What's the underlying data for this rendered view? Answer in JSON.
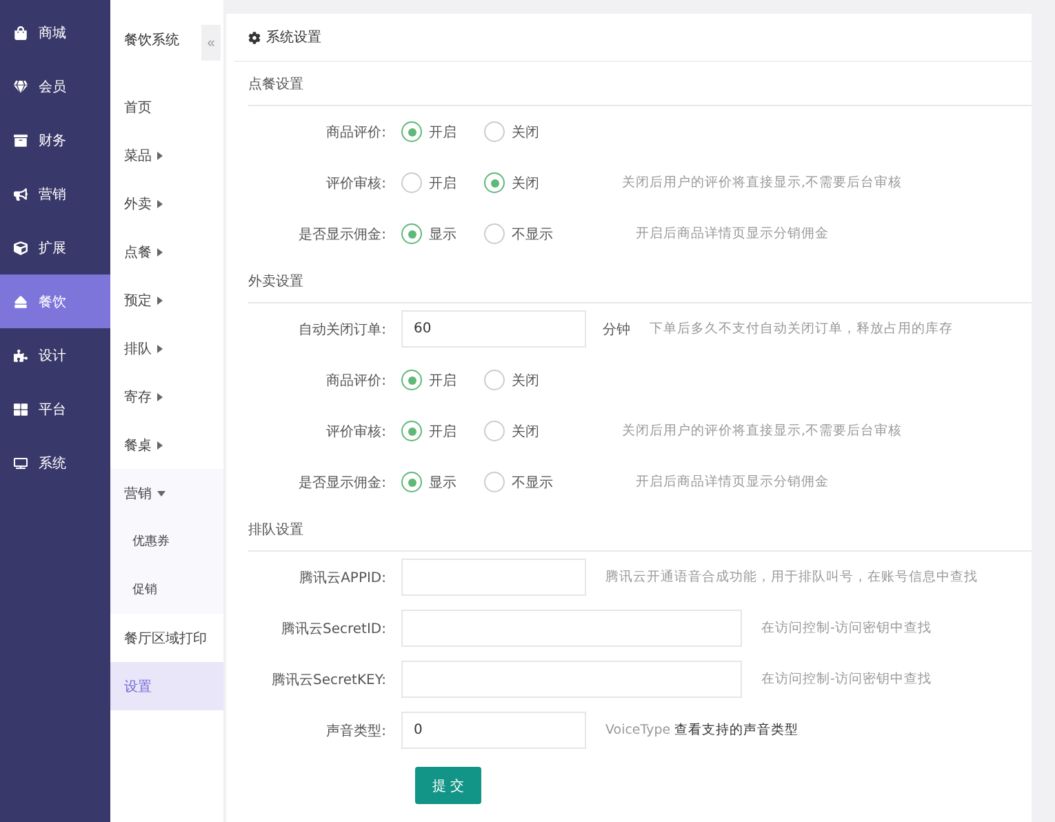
{
  "nav": [
    {
      "label": "商城",
      "selected": false
    },
    {
      "label": "会员",
      "selected": false
    },
    {
      "label": "财务",
      "selected": false
    },
    {
      "label": "营销",
      "selected": false
    },
    {
      "label": "扩展",
      "selected": false
    },
    {
      "label": "餐饮",
      "selected": true
    },
    {
      "label": "设计",
      "selected": false
    },
    {
      "label": "平台",
      "selected": false
    },
    {
      "label": "系统",
      "selected": false
    }
  ],
  "subnav": {
    "title": "餐饮系统",
    "collapse": "«",
    "items": [
      {
        "kind": "link",
        "label": "首页",
        "selected": false
      },
      {
        "kind": "group",
        "label": "菜品",
        "expanded": false,
        "selected": false
      },
      {
        "kind": "group",
        "label": "外卖",
        "expanded": false,
        "selected": false
      },
      {
        "kind": "group",
        "label": "点餐",
        "expanded": false,
        "selected": false
      },
      {
        "kind": "group",
        "label": "预定",
        "expanded": false,
        "selected": false
      },
      {
        "kind": "group",
        "label": "排队",
        "expanded": false,
        "selected": false
      },
      {
        "kind": "group",
        "label": "寄存",
        "expanded": false,
        "selected": false
      },
      {
        "kind": "group",
        "label": "餐桌",
        "expanded": false,
        "selected": false
      },
      {
        "kind": "group",
        "label": "营销",
        "expanded": true,
        "selected": false,
        "children": [
          {
            "label": "优惠券",
            "selected": false
          },
          {
            "label": "促销",
            "selected": false
          }
        ]
      },
      {
        "kind": "link",
        "label": "餐厅区域打印",
        "selected": false
      },
      {
        "kind": "link",
        "label": "设置",
        "selected": true
      }
    ]
  },
  "panel": {
    "title": "系统设置",
    "sections": [
      {
        "title": "点餐设置",
        "rows": [
          {
            "kind": "radio",
            "label": "商品评价:",
            "options": [
              {
                "label": "开启",
                "selected": true
              },
              {
                "label": "关闭",
                "selected": false
              }
            ]
          },
          {
            "kind": "radio",
            "label": "评价审核:",
            "options": [
              {
                "label": "开启",
                "selected": false
              },
              {
                "label": "关闭",
                "selected": true
              }
            ],
            "hint": "关闭后用户的评价将直接显示,不需要后台审核"
          },
          {
            "kind": "radio",
            "label": "是否显示佣金:",
            "options": [
              {
                "label": "显示",
                "selected": true
              },
              {
                "label": "不显示",
                "selected": false
              }
            ],
            "hint": "开启后商品详情页显示分销佣金"
          }
        ]
      },
      {
        "title": "外卖设置",
        "rows": [
          {
            "kind": "input",
            "label": "自动关闭订单:",
            "value": "60",
            "unit": "分钟",
            "hint": "下单后多久不支付自动关闭订单，释放占用的库存"
          },
          {
            "kind": "radio",
            "label": "商品评价:",
            "options": [
              {
                "label": "开启",
                "selected": true
              },
              {
                "label": "关闭",
                "selected": false
              }
            ]
          },
          {
            "kind": "radio",
            "label": "评价审核:",
            "options": [
              {
                "label": "开启",
                "selected": true
              },
              {
                "label": "关闭",
                "selected": false
              }
            ],
            "hint": "关闭后用户的评价将直接显示,不需要后台审核"
          },
          {
            "kind": "radio",
            "label": "是否显示佣金:",
            "options": [
              {
                "label": "显示",
                "selected": true
              },
              {
                "label": "不显示",
                "selected": false
              }
            ],
            "hint": "开启后商品详情页显示分销佣金"
          }
        ]
      },
      {
        "title": "排队设置",
        "rows": [
          {
            "kind": "input",
            "label": "腾讯云APPID:",
            "hint": "腾讯云开通语音合成功能，用于排队叫号，在账号信息中查找"
          },
          {
            "kind": "wide",
            "label": "腾讯云SecretID:",
            "hint": "在访问控制-访问密钥中查找"
          },
          {
            "kind": "wide",
            "label": "腾讯云SecretKEY:",
            "hint": "在访问控制-访问密钥中查找"
          },
          {
            "kind": "input",
            "label": "声音类型:",
            "value": "0",
            "hint": "VoiceType",
            "link": "查看支持的声音类型"
          }
        ]
      }
    ],
    "submit": "提 交"
  }
}
